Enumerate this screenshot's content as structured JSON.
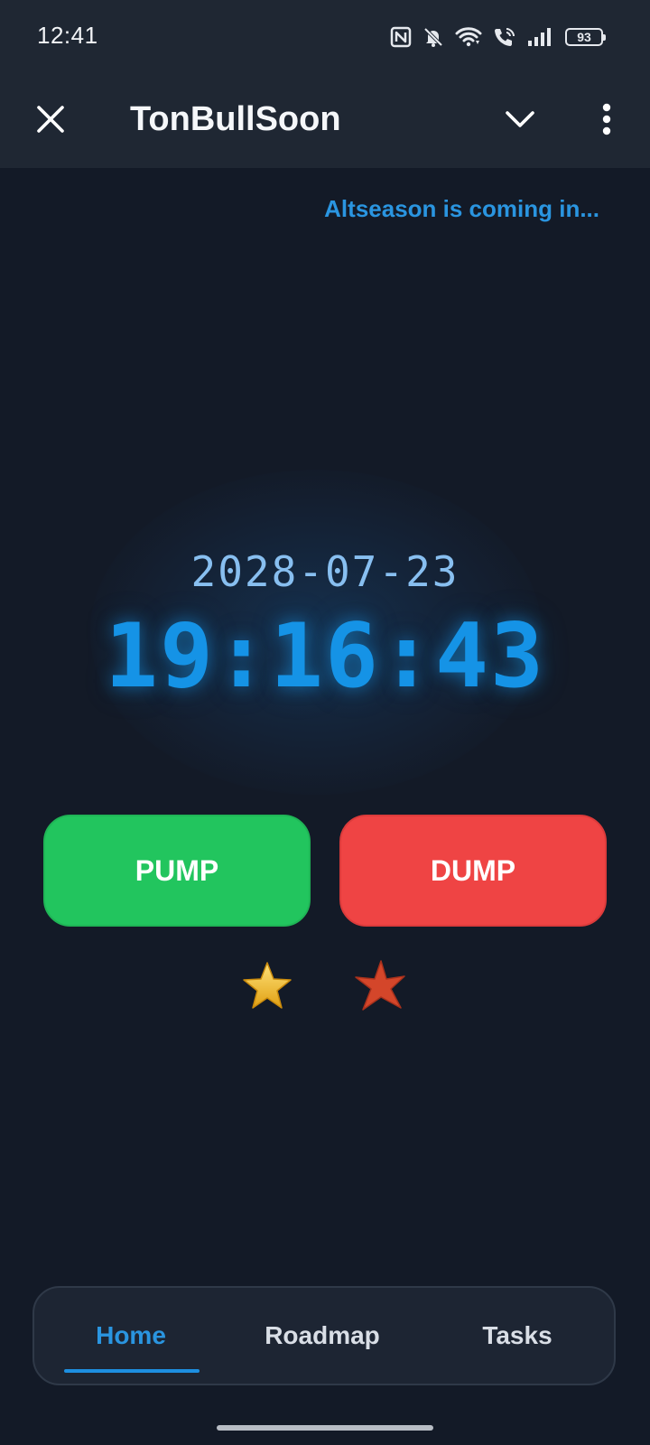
{
  "status_bar": {
    "time": "12:41",
    "battery": "93",
    "icons": [
      "nfc-icon",
      "bell-off-icon",
      "wifi-icon",
      "wifi-call-icon",
      "signal-icon",
      "battery-icon"
    ]
  },
  "header": {
    "title": "TonBullSoon",
    "icons": [
      "close-icon",
      "chevron-down-icon",
      "more-vertical-icon"
    ]
  },
  "main": {
    "tagline": "Altseason is coming in...",
    "countdown_date": "2028-07-23",
    "countdown_time": "19:16:43",
    "pump_label": "PUMP",
    "dump_label": "DUMP",
    "decorations": [
      "star-gold-icon",
      "star-red-icon"
    ]
  },
  "nav": {
    "items": [
      {
        "label": "Home",
        "active": true
      },
      {
        "label": "Roadmap",
        "active": false
      },
      {
        "label": "Tasks",
        "active": false
      }
    ]
  },
  "colors": {
    "accent": "#1593e6",
    "pump": "#22c55e",
    "dump": "#ef4444",
    "background": "#131a27",
    "header": "#1f2733"
  }
}
